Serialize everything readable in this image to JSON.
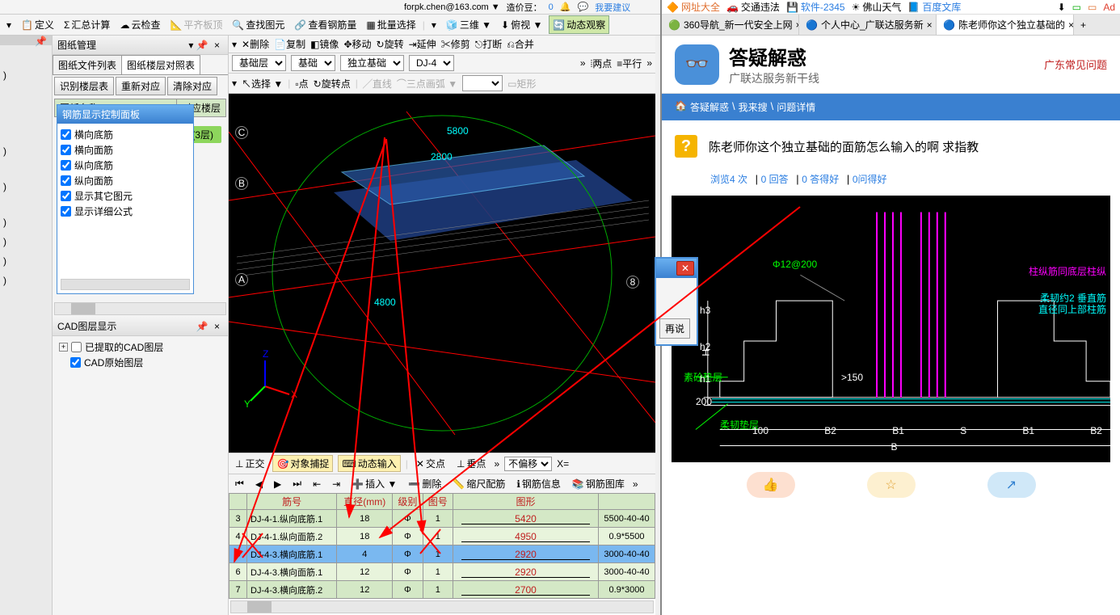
{
  "top": {
    "email": "forpk.chen@163.com ▼",
    "credits_label": "造价豆：",
    "credits_value": "0",
    "suggest": "我要建议"
  },
  "toolbar": {
    "define": "定义",
    "sum_calc": "汇总计算",
    "cloud_check": "云检查",
    "flat_top": "平齐板顶",
    "find_entity": "查找图元",
    "view_rebar": "查看钢筋量",
    "batch_select": "批量选择",
    "view3d": "三维 ▼",
    "overlook": "俯视 ▼",
    "dynamic_view": "动态观察"
  },
  "drawing_mgr": {
    "title": "图纸管理",
    "tabs": [
      "图纸文件列表",
      "图纸楼层对照表"
    ],
    "buttons": [
      "识别楼层表",
      "重新对应",
      "清除对应"
    ],
    "floor_header": "对应楼层",
    "floor_value": "(3层)",
    "doc_header": "图纸"
  },
  "rebar_panel": {
    "title": "钢筋显示控制面板",
    "items": [
      "横向底筋",
      "横向面筋",
      "纵向底筋",
      "纵向面筋",
      "显示其它图元",
      "显示详细公式"
    ]
  },
  "cad_layer": {
    "title": "CAD图层显示",
    "items": [
      "已提取的CAD图层",
      "CAD原始图层"
    ]
  },
  "center_tools": {
    "row1": [
      "删除",
      "复制",
      "镜像",
      "移动",
      "旋转",
      "延伸",
      "修剪",
      "打断",
      "合并"
    ],
    "selects": [
      "基础层",
      "基础",
      "独立基础",
      "DJ-4"
    ],
    "row1_right": [
      "两点",
      "平行"
    ],
    "row2_left": [
      "选择 ▼",
      "点",
      "旋转点"
    ],
    "row2_right": [
      "直线",
      "三点画弧 ▼",
      "矩形"
    ],
    "bottom1": [
      "正交",
      "对象捕捉",
      "动态输入",
      "交点",
      "垂点"
    ],
    "bottom1_select": "不偏移",
    "bottom1_x": "X=",
    "bottom2": [
      "插入 ▼",
      "删除",
      "缩尺配筋",
      "钢筋信息",
      "钢筋图库"
    ]
  },
  "viewport_labels": {
    "a": "A",
    "b": "B",
    "c": "C",
    "eight": "8",
    "dim1": "5800",
    "dim2": "2800",
    "dim3": "4800",
    "axes": [
      "X",
      "Y",
      "Z"
    ]
  },
  "rebar_table": {
    "headers": [
      "",
      "筋号",
      "直径(mm)",
      "级别",
      "图号",
      "图形",
      ""
    ],
    "rows": [
      {
        "n": "3",
        "name": "DJ-4-1.纵向底筋.1",
        "d": "18",
        "lvl": "Φ",
        "g": "1",
        "val": "5420",
        "r": "5500-40-40"
      },
      {
        "n": "4",
        "name": "DJ-4-1.纵向面筋.2",
        "d": "18",
        "lvl": "Φ",
        "g": "1",
        "val": "4950",
        "r": "0.9*5500"
      },
      {
        "n": "5",
        "name": "DJ-4-3.横向底筋.1",
        "d": "4",
        "lvl": "Φ",
        "g": "1",
        "val": "2920",
        "r": "3000-40-40"
      },
      {
        "n": "6",
        "name": "DJ-4-3.横向面筋.1",
        "d": "12",
        "lvl": "Φ",
        "g": "1",
        "val": "2920",
        "r": "3000-40-40"
      },
      {
        "n": "7",
        "name": "DJ-4-3.横向底筋.2",
        "d": "12",
        "lvl": "Φ",
        "g": "1",
        "val": "2700",
        "r": "0.9*3000"
      }
    ]
  },
  "dialog": {
    "btn": "再说"
  },
  "browser": {
    "bookmarks": [
      "网址大全",
      "交通违法",
      "软件-2345",
      "佛山天气",
      "百度文库"
    ],
    "tabs": [
      {
        "label": "360导航_新一代安全上网"
      },
      {
        "label": "个人中心_广联达服务新"
      },
      {
        "label": "陈老师你这个独立基础的"
      }
    ],
    "brand_main": "答疑解惑",
    "brand_sub": "广联达服务新干线",
    "region": "广东常见问题",
    "breadcrumb": [
      "答疑解惑",
      "我来搜",
      "问题详情"
    ],
    "question": "陈老师你这个独立基础的面筋怎么输入的啊 求指教",
    "stats": {
      "views": "浏览4 次",
      "ans": "0 回答",
      "good": "0 答得好",
      "ask": "0问得好"
    },
    "cad": {
      "spec": "Φ12@200",
      "note1": "柱纵筋同底层柱纵",
      "note2": "柔韧约2 垂直筋",
      "note3": "直径同上部柱筋",
      "note4": "素砼垫层",
      "note5": "柔韧垫层",
      "gap": ">150",
      "labels": [
        "100",
        "B2",
        "B1",
        "S",
        "B1",
        "B2"
      ],
      "b": "B",
      "h": [
        "h3",
        "h2",
        "h1",
        "200",
        "H"
      ]
    }
  }
}
